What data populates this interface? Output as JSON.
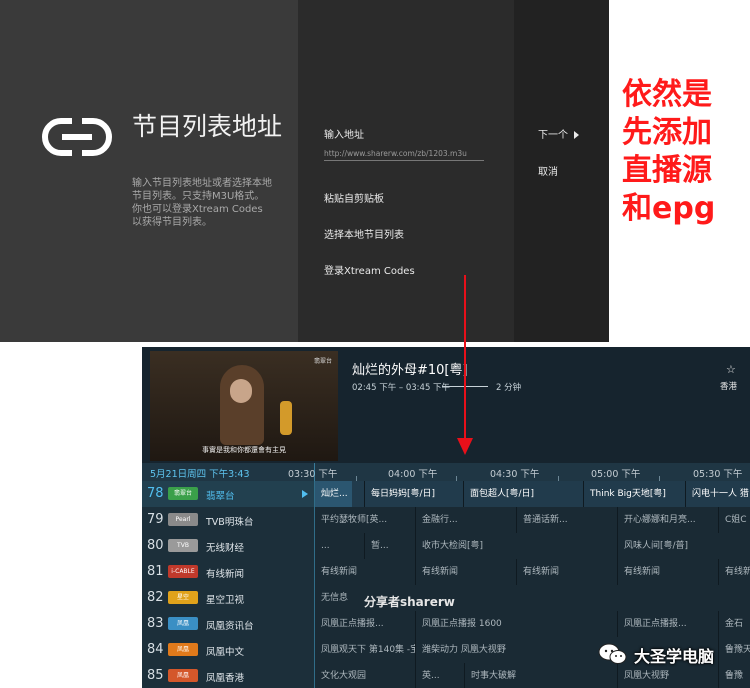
{
  "setup": {
    "title": "节目列表地址",
    "description": "输入节目列表地址或者选择本地节目列表。只支持M3U格式。你也可以登录Xtream Codes以获得节目列表。",
    "url_label": "输入地址",
    "url_value": "http://www.sharerw.com/zb/1203.m3u",
    "paste_label": "粘贴自剪贴板",
    "local_label": "选择本地节目列表",
    "xtream_label": "登录Xtream Codes",
    "next_label": "下一个",
    "cancel_label": "取消",
    "icon": "link-icon"
  },
  "annotation": {
    "lines": [
      "依然是",
      "先添加",
      "直播源",
      "和epg"
    ],
    "color": "#ff1a1a"
  },
  "player": {
    "watermark": "翡翠台",
    "subtitle": "事實是我和你都還會有主見",
    "program_title": "灿烂的外母#10[粤]",
    "time_range": "02:45 下午 – 03:45 下午",
    "duration": "2 分钟",
    "region": "香港",
    "star_icon": "star-icon"
  },
  "epg": {
    "date": "5月21日周四 下午3:43",
    "times": [
      "03:30 下午",
      "04:00 下午",
      "04:30 下午",
      "05:00 下午",
      "05:30 下午"
    ],
    "channels": [
      {
        "num": "78",
        "name": "翡翠台",
        "logo_color": "#3aa04a",
        "logo_text": "翡翠台",
        "selected": true,
        "programs": [
          {
            "t": "灿烂..."
          },
          {
            "t": "每日妈妈[粤/日]"
          },
          {
            "t": "面包超人[粤/日]"
          },
          {
            "t": "Think Big天地[粤]"
          },
          {
            "t": "闪电十一人 猎"
          }
        ]
      },
      {
        "num": "79",
        "name": "TVB明珠台",
        "logo_color": "#8a8a8a",
        "logo_text": "Pearl",
        "selected": false,
        "programs": [
          {
            "t": "平约瑟牧师[英..."
          },
          {
            "t": "金融行..."
          },
          {
            "t": "普通话新..."
          },
          {
            "t": "开心娜娜和月亮..."
          },
          {
            "t": "C姐C"
          }
        ]
      },
      {
        "num": "80",
        "name": "无线财经",
        "logo_color": "#9a9a9a",
        "logo_text": "TVB",
        "selected": false,
        "programs": [
          {
            "t": "..."
          },
          {
            "t": "暂..."
          },
          {
            "t": "收市大检阅[粤]"
          },
          {
            "t": "风味人间[粤/普]"
          }
        ]
      },
      {
        "num": "81",
        "name": "有线新闻",
        "logo_color": "#c0392b",
        "logo_text": "i-CABLE",
        "selected": false,
        "programs": [
          {
            "t": "有线新闻"
          },
          {
            "t": "有线新闻"
          },
          {
            "t": "有线新闻"
          },
          {
            "t": "有线新闻"
          },
          {
            "t": "有线新"
          }
        ]
      },
      {
        "num": "82",
        "name": "星空卫视",
        "logo_color": "#e0a21b",
        "logo_text": "星空",
        "selected": false,
        "programs": [
          {
            "t": "无信息"
          }
        ]
      },
      {
        "num": "83",
        "name": "凤凰资讯台",
        "logo_color": "#3a8fc4",
        "logo_text": "凤凰",
        "selected": false,
        "programs": [
          {
            "t": "凤凰正点播报..."
          },
          {
            "t": "凤凰正点播报 1600"
          },
          {
            "t": "凤凰正点播报..."
          },
          {
            "t": "金石"
          }
        ]
      },
      {
        "num": "84",
        "name": "凤凰中文",
        "logo_color": "#e07a1b",
        "logo_text": "凤凰",
        "selected": false,
        "programs": [
          {
            "t": "凤凰观天下 第140集 -宝..."
          },
          {
            "t": "潍柴动力 凤凰大视野"
          },
          {
            "t": "鲁豫天天"
          }
        ]
      },
      {
        "num": "85",
        "name": "凤凰香港",
        "logo_color": "#d4572a",
        "logo_text": "凤凰",
        "selected": false,
        "programs": [
          {
            "t": "文化大观园"
          },
          {
            "t": "英..."
          },
          {
            "t": "时事大破解"
          },
          {
            "t": "凤凰大视野"
          },
          {
            "t": "鲁豫"
          }
        ]
      }
    ],
    "overlay_watermark": "分享者sharerw"
  },
  "wechat": {
    "account": "大圣学电脑",
    "icon": "wechat-icon"
  }
}
